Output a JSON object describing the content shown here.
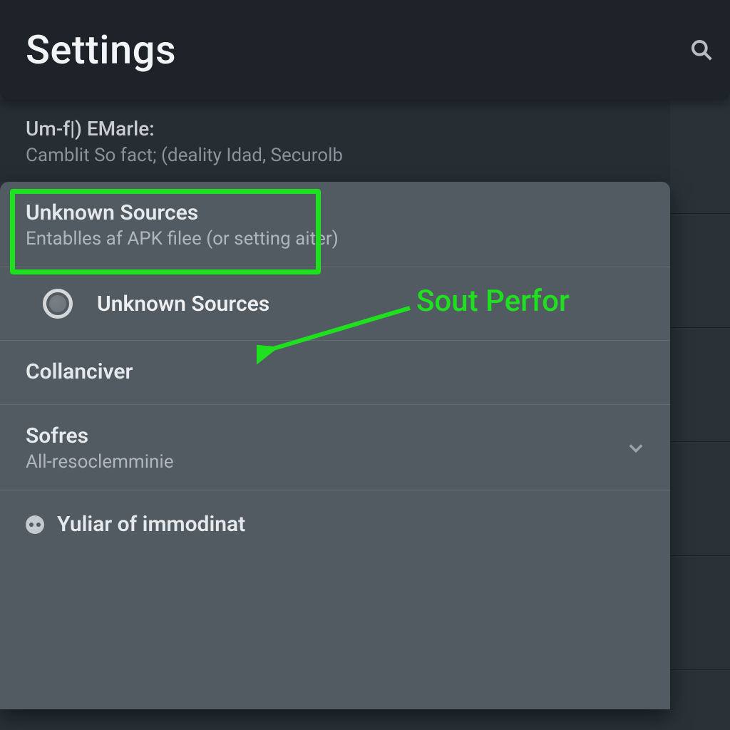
{
  "header": {
    "title": "Settings",
    "search_icon": "search-icon"
  },
  "account": {
    "title": "Um-f|) EMarle:",
    "subtitle": "Camblit So fact; (deality Idad, Securolb"
  },
  "panel": {
    "unknown_sources": {
      "title": "Unknown Sources",
      "subtitle": "Entablles af APK filee (or setting  aiter)"
    },
    "radio_label": "Unknown Sources",
    "collanciver_title": "Collanciver",
    "sofres": {
      "title": "Sofres",
      "subtitle": "All-resoclemminie"
    },
    "bottom_label": "Yuliar of immodinat"
  },
  "annotation": {
    "text": "Sout Perfor",
    "highlight_color": "#1fe01f"
  }
}
